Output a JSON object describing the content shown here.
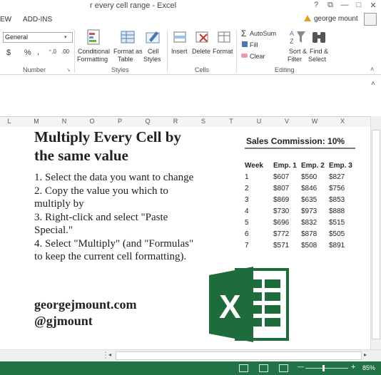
{
  "window": {
    "title": "r every cell range - Excel",
    "help": "?",
    "restore": "⧉",
    "minimize": "—",
    "maximize": "□",
    "close": "✕"
  },
  "tabs": [
    "EW",
    "ADD-INS"
  ],
  "account": {
    "name": "george mount"
  },
  "ribbon": {
    "number_format": "General",
    "currency_symbol": "$",
    "percent_symbol": "%",
    "comma_symbol": ",",
    "inc_decimal": "⁺.0",
    "dec_decimal": ".00",
    "conditional_formatting": [
      "Conditional",
      "Formatting"
    ],
    "format_as_table": [
      "Format as",
      "Table"
    ],
    "cell_styles": [
      "Cell",
      "Styles"
    ],
    "insert": "Insert",
    "delete": "Delete",
    "format": "Format",
    "autosum": "AutoSum",
    "fill": "Fill",
    "clear": "Clear",
    "sort_filter": [
      "Sort &",
      "Filter"
    ],
    "find_select": [
      "Find &",
      "Select"
    ],
    "groups": {
      "number": "Number",
      "styles": "Styles",
      "cells": "Cells",
      "editing": "Editing"
    }
  },
  "columns": [
    "L",
    "M",
    "N",
    "O",
    "P",
    "Q",
    "R",
    "S",
    "T",
    "U",
    "V",
    "W",
    "X"
  ],
  "sheet": {
    "heading_line1": "Multiply Every Cell by",
    "heading_line2": "the same value",
    "steps": [
      "1. Select the data you want to change",
      "2. Copy the value you which to",
      "multiply by",
      "3. Right-click and select \"Paste",
      "Special.\"",
      "4. Select \"Multiply\" (and \"Formulas\"",
      "to keep the current cell formatting)."
    ],
    "website": "georgejmount.com",
    "handle": "@gjmount",
    "commission_title": "Sales Commission:  10%",
    "table_headers": [
      "Week",
      "Emp. 1",
      "Emp. 2",
      "Emp. 3"
    ],
    "table_rows": [
      [
        "1",
        "$607",
        "$560",
        "$827"
      ],
      [
        "2",
        "$807",
        "$846",
        "$756"
      ],
      [
        "3",
        "$869",
        "$635",
        "$853"
      ],
      [
        "4",
        "$730",
        "$973",
        "$888"
      ],
      [
        "5",
        "$696",
        "$832",
        "$515"
      ],
      [
        "6",
        "$772",
        "$878",
        "$505"
      ],
      [
        "7",
        "$571",
        "$508",
        "$891"
      ]
    ],
    "logo_letter": "X"
  },
  "status": {
    "zoom": "85%",
    "zoom_minus": "—",
    "zoom_plus": "+"
  },
  "colors": {
    "excel_green": "#217346",
    "logo_dark": "#1e6b3c",
    "logo_light": "#3fa363"
  }
}
